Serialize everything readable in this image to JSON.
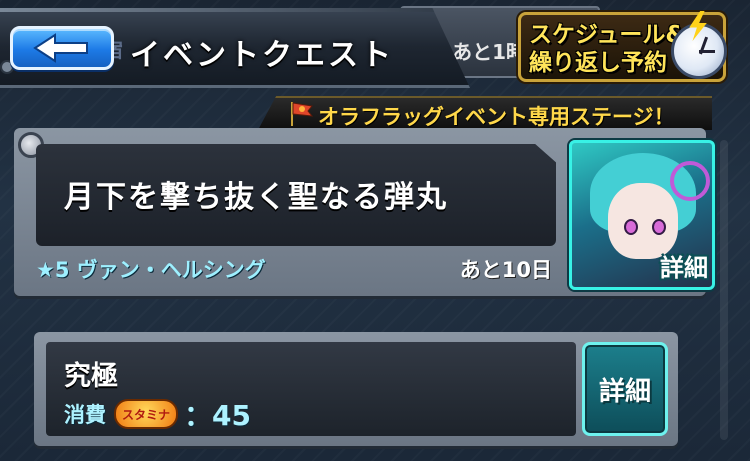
{
  "header": {
    "title": "イベントクエスト",
    "behind_text": "あと1時",
    "behind_ghost": "宿"
  },
  "schedule_button": {
    "line1": "スケジュール&",
    "line2": "繰り返し予約"
  },
  "event_banner": {
    "text": "オラフラッグイベント専用ステージ！"
  },
  "quest": {
    "name": "月下を撃ち抜く聖なる弾丸",
    "rarity_label": "★5 ヴァン・ヘルシング",
    "remaining": "あと10日",
    "detail_label": "詳細"
  },
  "difficulty": {
    "name": "究極",
    "stamina_label": "消費",
    "stamina_badge": "スタミナ",
    "stamina_value": "：45",
    "detail_label": "詳細"
  },
  "colors": {
    "accent_cyan": "#6ef2ee",
    "banner_yellow": "#ffd84a",
    "back_blue": "#1d7ae6"
  }
}
